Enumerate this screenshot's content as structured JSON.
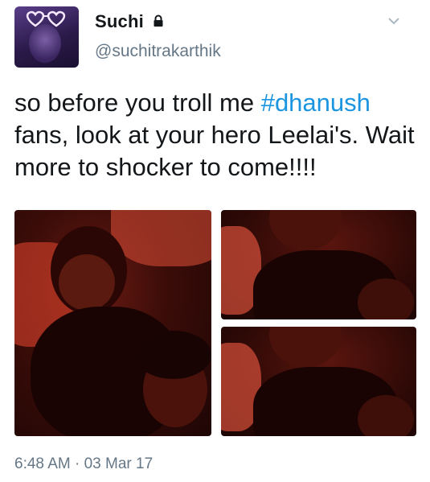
{
  "user": {
    "name": "Suchi",
    "handle": "@suchitrakarthik",
    "protected_icon": "lock-icon",
    "avatar_icon": "avatar"
  },
  "menu": {
    "icon": "chevron-down-icon"
  },
  "tweet": {
    "text_part1": "so before you troll me ",
    "hashtag": "#dhanush",
    "text_part2": " fans, look at your hero Leelai's. Wait more to shocker to come!!!!"
  },
  "media": {
    "photo_count": 3
  },
  "meta": {
    "timestamp": "6:48 AM · 03 Mar 17"
  },
  "colors": {
    "text": "#14171a",
    "secondary": "#657786",
    "link": "#1b95e0"
  }
}
